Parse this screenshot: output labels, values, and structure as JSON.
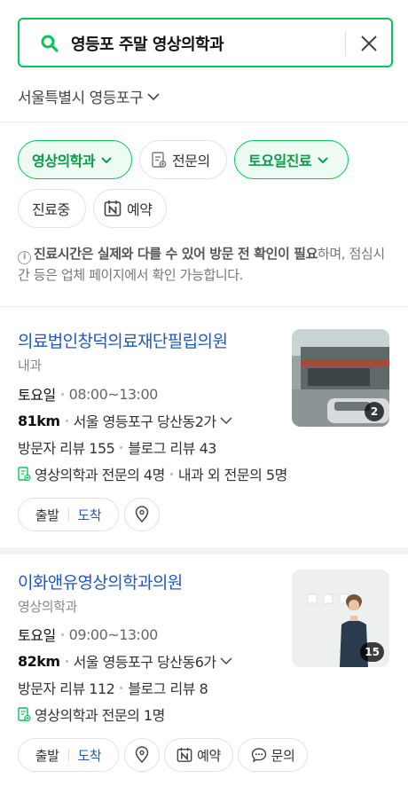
{
  "search": {
    "query": "영등포 주말 영상의학과"
  },
  "region": {
    "label": "서울특별시 영등포구"
  },
  "filters": {
    "specialty": "영상의학과",
    "specialist": "전문의",
    "saturday": "토요일진료",
    "open_now": "진료중",
    "reservation": "예약"
  },
  "notice": {
    "bold_part": "진료시간은 실제와 다를 수 있어 방문 전 확인이 필요",
    "rest": "하며, 점심시간 등은 업체 페이지에서 확인 가능합니다."
  },
  "results": [
    {
      "name": "의료법인창덕의료재단필립의원",
      "category": "내과",
      "day": "토요일",
      "hours": "08:00~13:00",
      "distance": "81km",
      "address": "서울 영등포구 당산동2가",
      "visitor_review": "방문자 리뷰 155",
      "blog_review": "블로그 리뷰 43",
      "specialist_1": "영상의학과 전문의 4명",
      "specialist_2": "내과 외 전문의 5명",
      "photo_count": "2",
      "depart": "출발",
      "arrive": "도착"
    },
    {
      "name": "이화앤유영상의학과의원",
      "category": "영상의학과",
      "day": "토요일",
      "hours": "09:00~13:00",
      "distance": "82km",
      "address": "서울 영등포구 당산동6가",
      "visitor_review": "방문자 리뷰 112",
      "blog_review": "블로그 리뷰 8",
      "specialist_1": "영상의학과 전문의 1명",
      "photo_count": "15",
      "depart": "출발",
      "arrive": "도착",
      "reserve": "예약",
      "inquiry": "문의"
    }
  ],
  "colors": {
    "accent_green": "#03c75a",
    "link_blue": "#1f57c3"
  }
}
